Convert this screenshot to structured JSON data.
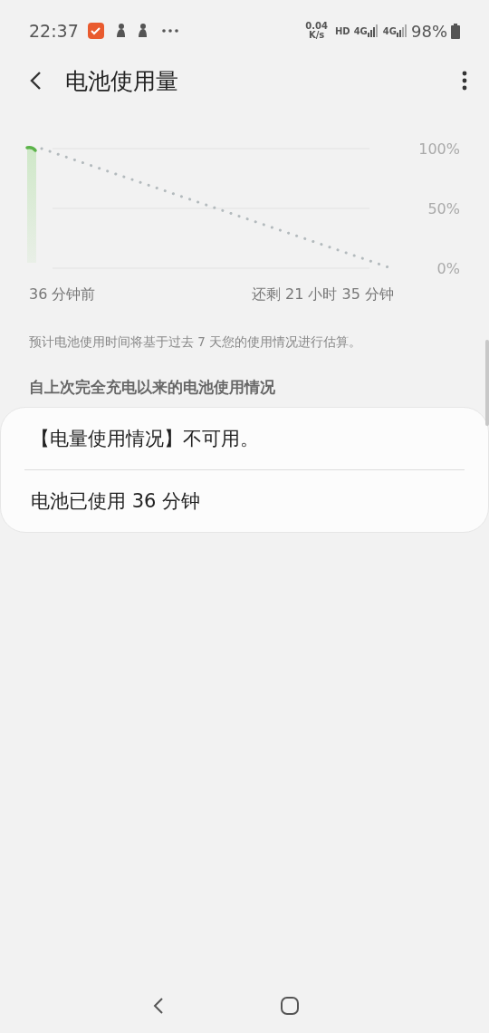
{
  "status_bar": {
    "time": "22:37",
    "speed_value": "0.04",
    "speed_unit": "K/s",
    "hd": "HD",
    "network_1": "4G",
    "network_2": "4G",
    "battery": "98%"
  },
  "top_bar": {
    "title": "电池使用量"
  },
  "chart": {
    "start_label": "36 分钟前",
    "end_label": "还剩 21 小时 35 分钟",
    "y_labels": [
      "100%",
      "50%",
      "0%"
    ]
  },
  "note": "预计电池使用时间将基于过去 7 天您的使用情况进行估算。",
  "section": {
    "header": "自上次完全充电以来的电池使用情况",
    "items": [
      "【电量使用情况】不可用。",
      "电池已使用 36 分钟"
    ]
  }
}
